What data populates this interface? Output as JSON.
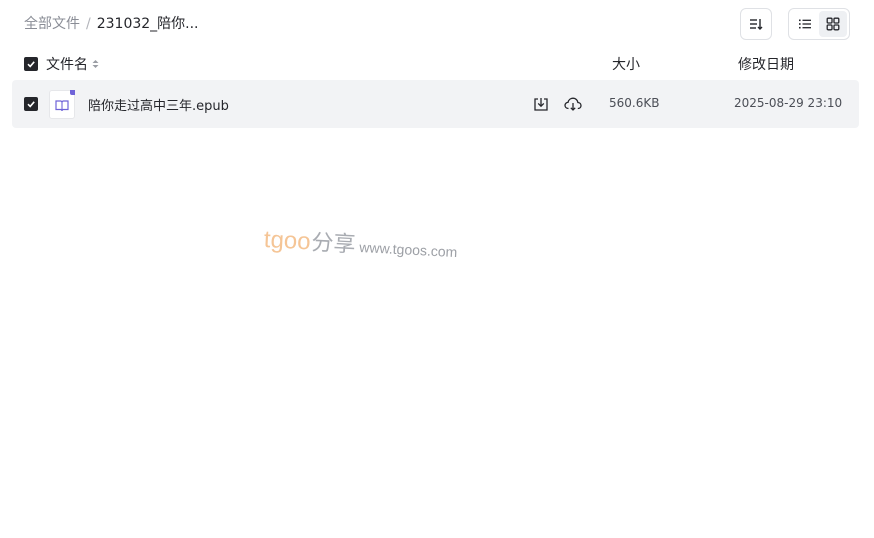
{
  "breadcrumb": {
    "root": "全部文件",
    "separator": "/",
    "current": "231032_陪你..."
  },
  "toolbar": {
    "sort_icon": "sort-icon",
    "list_view_icon": "list-view-icon",
    "grid_view_icon": "grid-view-icon"
  },
  "table": {
    "columns": {
      "name": "文件名",
      "size": "大小",
      "modified": "修改日期"
    },
    "rows": [
      {
        "name": "陪你走过高中三年.epub",
        "size": "560.6KB",
        "modified": "2025-08-29 23:10",
        "icon": "epub-book-icon",
        "checked": true
      }
    ]
  },
  "watermark": {
    "brand": "tgoo",
    "suffix": "分享",
    "url": "www.tgoos.com"
  },
  "colors": {
    "accent": "#6f63d8",
    "row_bg": "#f2f3f5",
    "checkbox": "#25262b",
    "watermark_orange": "#f5c596"
  }
}
